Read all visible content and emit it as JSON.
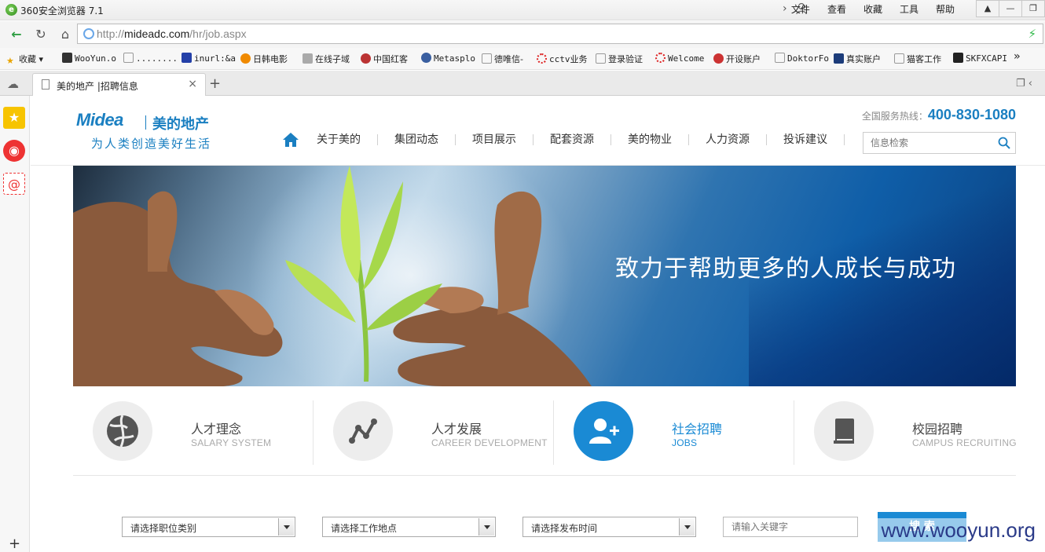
{
  "window": {
    "title": "360安全浏览器 7.1"
  },
  "top_menu": [
    "文件",
    "查看",
    "收藏",
    "工具",
    "帮助"
  ],
  "address_bar": {
    "scheme": "http://",
    "host": "mideadc.com",
    "path": "/hr/job.aspx"
  },
  "bookmarks": [
    "收藏",
    "WooYun.o",
    "........",
    "inurl:&a",
    "日韩电影",
    "在线子域",
    "中国红客",
    "Metasplo",
    "德唯信-",
    "cctv业务",
    "登录验证",
    "Welcome",
    "开设账户",
    "DoktorFo",
    "真实账户",
    "猫客工作",
    "SKFXCAPI"
  ],
  "tab": {
    "title": "美的地产 |招聘信息"
  },
  "site": {
    "logo_brand": "Midea",
    "logo_cn": "美的地产",
    "logo_slogan": "为人类创造美好生活",
    "hotline_label": "全国服务热线：",
    "hotline_number": "400-830-1080",
    "nav": [
      "关于美的",
      "集团动态",
      "项目展示",
      "配套资源",
      "美的物业",
      "人力资源",
      "投诉建议"
    ],
    "search_placeholder": "信息检索",
    "banner_text": "致力于帮助更多的人成长与成功",
    "features": [
      {
        "title": "人才理念",
        "subtitle": "SALARY SYSTEM",
        "icon": "globe-icon",
        "active": false
      },
      {
        "title": "人才发展",
        "subtitle": "CAREER DEVELOPMENT",
        "icon": "growth-chart-icon",
        "active": false
      },
      {
        "title": "社会招聘",
        "subtitle": "JOBS",
        "icon": "add-user-icon",
        "active": true
      },
      {
        "title": "校园招聘",
        "subtitle": "CAMPUS RECRUITING",
        "icon": "book-icon",
        "active": false
      }
    ],
    "filters": {
      "job_category": "请选择职位类别",
      "location": "请选择工作地点",
      "publish_time": "请选择发布时间",
      "keyword_placeholder": "请输入关键字",
      "search_button": "搜 索"
    },
    "watermark": "www.wooyun.org"
  },
  "colors": {
    "brand_blue": "#1a8ad4",
    "logo_blue": "#1a7fc1"
  }
}
